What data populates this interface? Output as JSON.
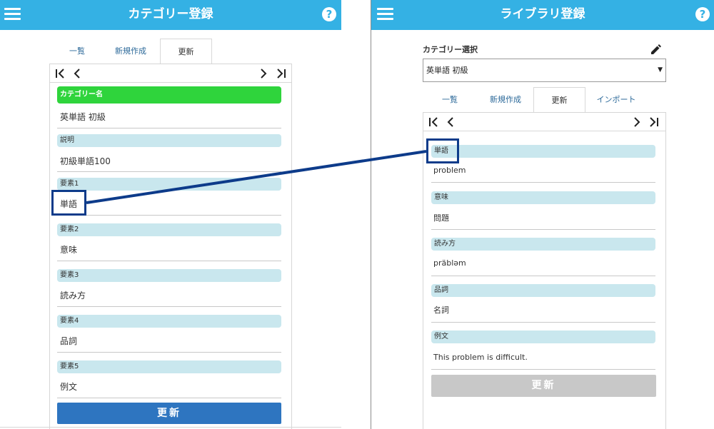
{
  "left": {
    "header": {
      "title": "カテゴリー登録",
      "help": "?"
    },
    "tabs": [
      "一覧",
      "新規作成",
      "更新"
    ],
    "active_tab_index": 2,
    "fields": [
      {
        "label": "カテゴリー名",
        "value": "英単語 初級"
      },
      {
        "label": "説明",
        "value": "初級単語100"
      },
      {
        "label": "要素1",
        "value": "単語"
      },
      {
        "label": "要素2",
        "value": "意味"
      },
      {
        "label": "要素3",
        "value": "読み方"
      },
      {
        "label": "要素4",
        "value": "品詞"
      },
      {
        "label": "要素5",
        "value": "例文"
      }
    ],
    "submit_label": "更新"
  },
  "right": {
    "header": {
      "title": "ライブラリ登録",
      "help": "?"
    },
    "category_select_label": "カテゴリー選択",
    "category_select_value": "英単語 初級",
    "tabs": [
      "一覧",
      "新規作成",
      "更新",
      "インポート"
    ],
    "active_tab_index": 2,
    "fields": [
      {
        "label": "単語",
        "value": "problem"
      },
      {
        "label": "意味",
        "value": "問題"
      },
      {
        "label": "読み方",
        "value": "präbləm"
      },
      {
        "label": "品詞",
        "value": "名詞"
      },
      {
        "label": "例文",
        "value": "This problem is difficult."
      }
    ],
    "submit_label": "更新"
  },
  "colors": {
    "appbar": "#34b1e4",
    "label_bar": "#c9e7ee",
    "category_name_bar": "#2fd43c",
    "submit_blue": "#2e75c0",
    "submit_disabled": "#c8c8c8",
    "highlight": "#0d3b8a"
  },
  "icons": {
    "menu": "hamburger-icon",
    "help": "question-circle-icon",
    "edit": "pencil-icon",
    "first": "first-page-icon",
    "prev": "chevron-left-icon",
    "next": "chevron-right-icon",
    "last": "last-page-icon",
    "select": "caret-down-icon"
  }
}
